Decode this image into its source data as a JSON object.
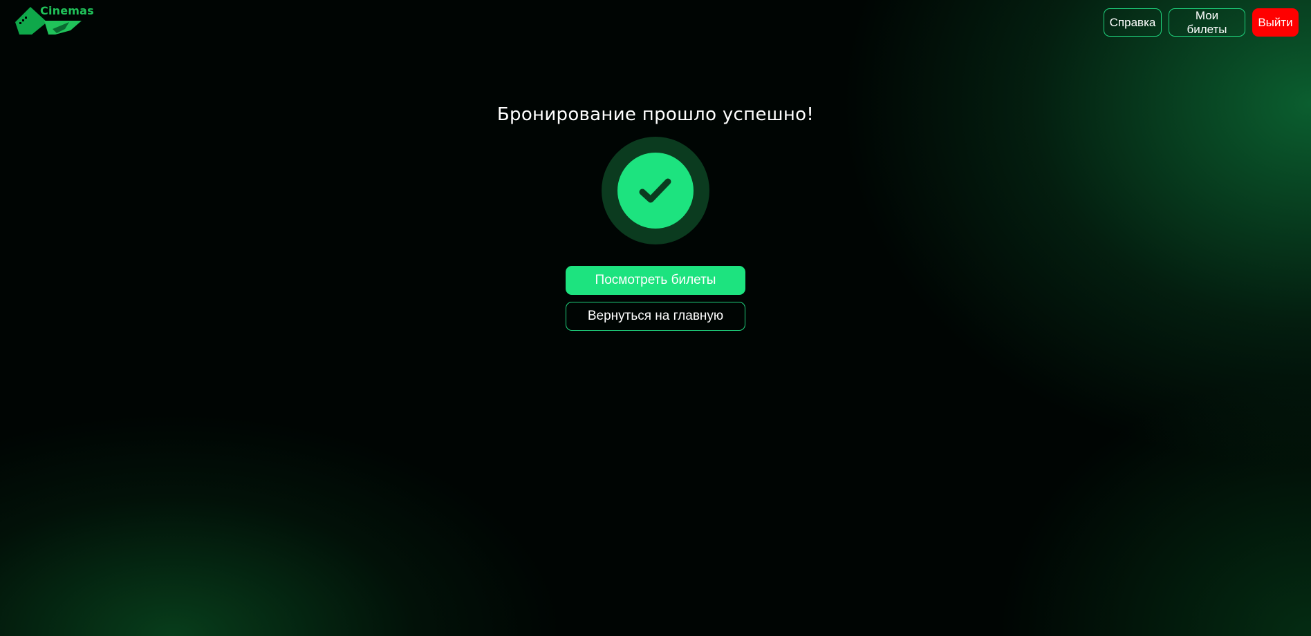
{
  "brand": {
    "name": "Cinemas",
    "accent_color": "#20c25a"
  },
  "header": {
    "nav": {
      "help_label": "Справка",
      "tickets_label": "Мои билеты",
      "logout_label": "Выйти"
    }
  },
  "main": {
    "title": "Бронирование прошло успешно!",
    "status_icon": "check-circle-icon",
    "view_tickets_label": "Посмотреть билеты",
    "home_label": "Вернуться на главную"
  },
  "colors": {
    "primary": "#1de37f",
    "outline": "#1fd47e",
    "danger": "#ff0000",
    "icon_ring": "#0b3b1f",
    "check_stroke": "#0b3b1f"
  }
}
